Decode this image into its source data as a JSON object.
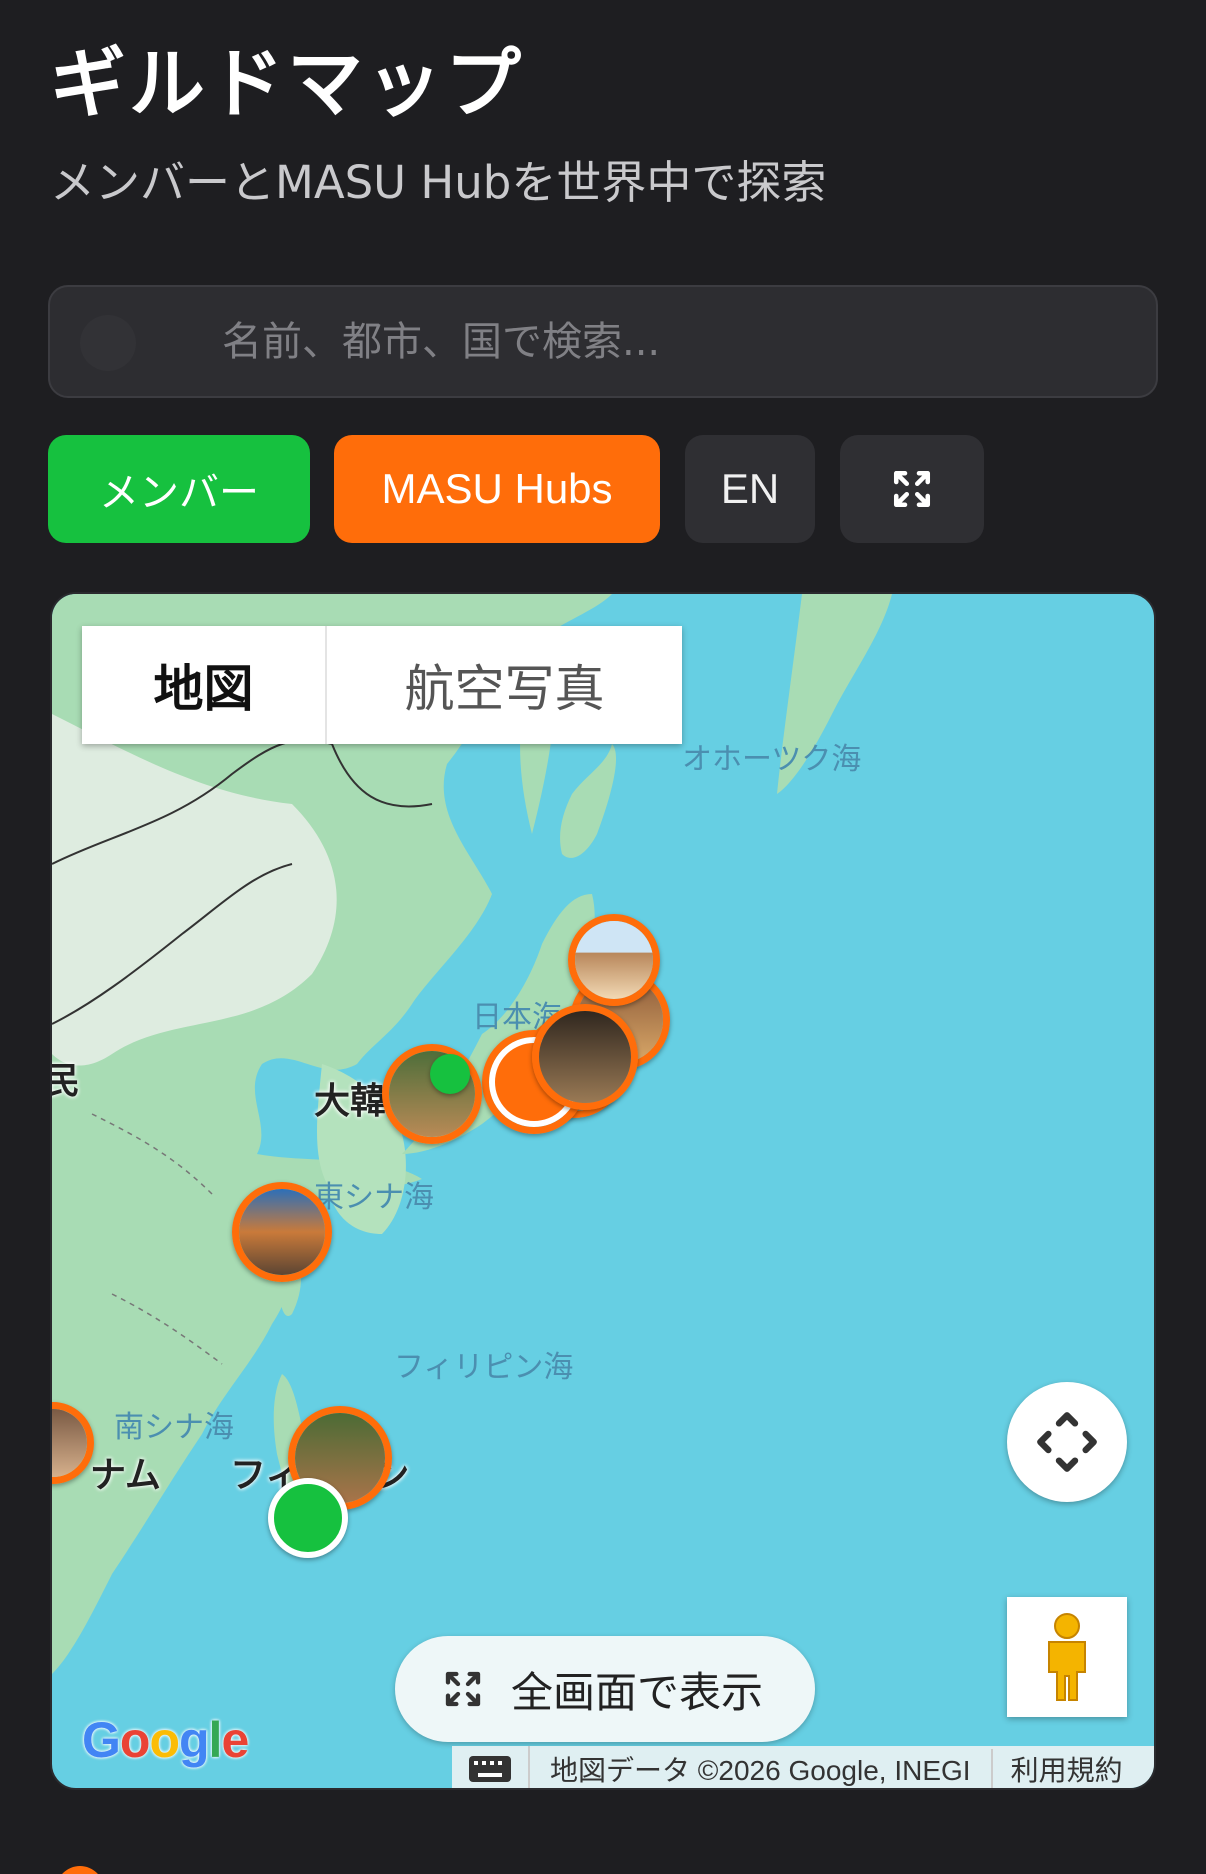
{
  "header": {
    "title": "ギルドマップ",
    "subtitle": "メンバーとMASU Hubを世界中で探索"
  },
  "search": {
    "placeholder": "名前、都市、国で検索...",
    "value": ""
  },
  "filters": {
    "members_label": "メンバー",
    "hubs_label": "MASU Hubs",
    "language_label": "EN",
    "expand_icon": "expand-icon"
  },
  "map": {
    "map_type_map": "地図",
    "map_type_satellite": "航空写真",
    "labels": {
      "okhotsk": "オホーツク海",
      "japan_sea": "日本海",
      "korea": "大韓",
      "east_china_sea": "東シナ海",
      "philippine_sea": "フィリピン海",
      "south_china_sea": "南シナ海",
      "vietnam": "ナム",
      "philippines": "フィリピン",
      "left_edge": "民"
    },
    "fullscreen_label": "全画面で表示",
    "logo": "Google",
    "attribution": "地図データ ©2026 Google, INEGI",
    "terms": "利用規約"
  },
  "colors": {
    "background": "#1e1e21",
    "members": "#16c13f",
    "hubs": "#ff6d0a",
    "water": "#66cfe3",
    "land": "#a6dcb1"
  }
}
